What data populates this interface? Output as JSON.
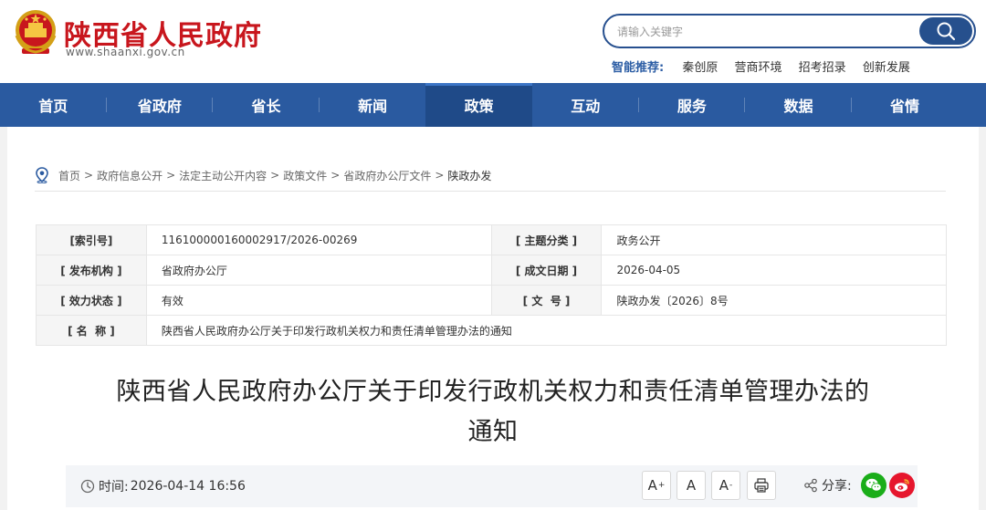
{
  "header": {
    "site_title": "陕西省人民政府",
    "site_url": "www.shaanxi.gov.cn",
    "search": {
      "placeholder": "请输入关键字"
    },
    "recommend": {
      "label": "智能推荐:",
      "items": [
        "秦创原",
        "营商环境",
        "招考招录",
        "创新发展"
      ]
    }
  },
  "nav": {
    "items": [
      "首页",
      "省政府",
      "省长",
      "新闻",
      "政策",
      "互动",
      "服务",
      "数据",
      "省情"
    ],
    "active": "政策"
  },
  "breadcrumb": {
    "items": [
      "首页",
      "政府信息公开",
      "法定主动公开内容",
      "政策文件",
      "省政府办公厅文件",
      "陕政办发"
    ],
    "separator": ">"
  },
  "info": {
    "index_label": "[索引号]",
    "index_value": "116100000160002917/2026-00269",
    "topic_label": "[ 主题分类 ]",
    "topic_value": "政务公开",
    "publisher_label": "[ 发布机构 ]",
    "publisher_value": "省政府办公厅",
    "date_label": "[ 成文日期 ]",
    "date_value": "2026-04-05",
    "status_label": "[ 效力状态 ]",
    "status_value": "有效",
    "docno_label": "[ 文  号 ]",
    "docno_value": "陕政办发〔2026〕8号",
    "name_label": "[ 名  称 ]",
    "name_value": "陕西省人民政府办公厅关于印发行政机关权力和责任清单管理办法的通知"
  },
  "document": {
    "title_line1": "陕西省人民政府办公厅关于印发行政机关权力和责任清单管理办法的",
    "title_line2": "通知"
  },
  "meta": {
    "time_label": "时间:",
    "time_value": "2026-04-14 16:56",
    "font_large": "A",
    "font_large_sup": "+",
    "font_normal": "A",
    "font_small": "A",
    "font_small_sup": "-",
    "share_label": "分享:"
  },
  "colors": {
    "brand_red": "#c8161d",
    "nav_blue": "#2a5aa0",
    "nav_active": "#1f4a88",
    "wechat_green": "#1aad19",
    "weibo_red": "#e6162d"
  }
}
